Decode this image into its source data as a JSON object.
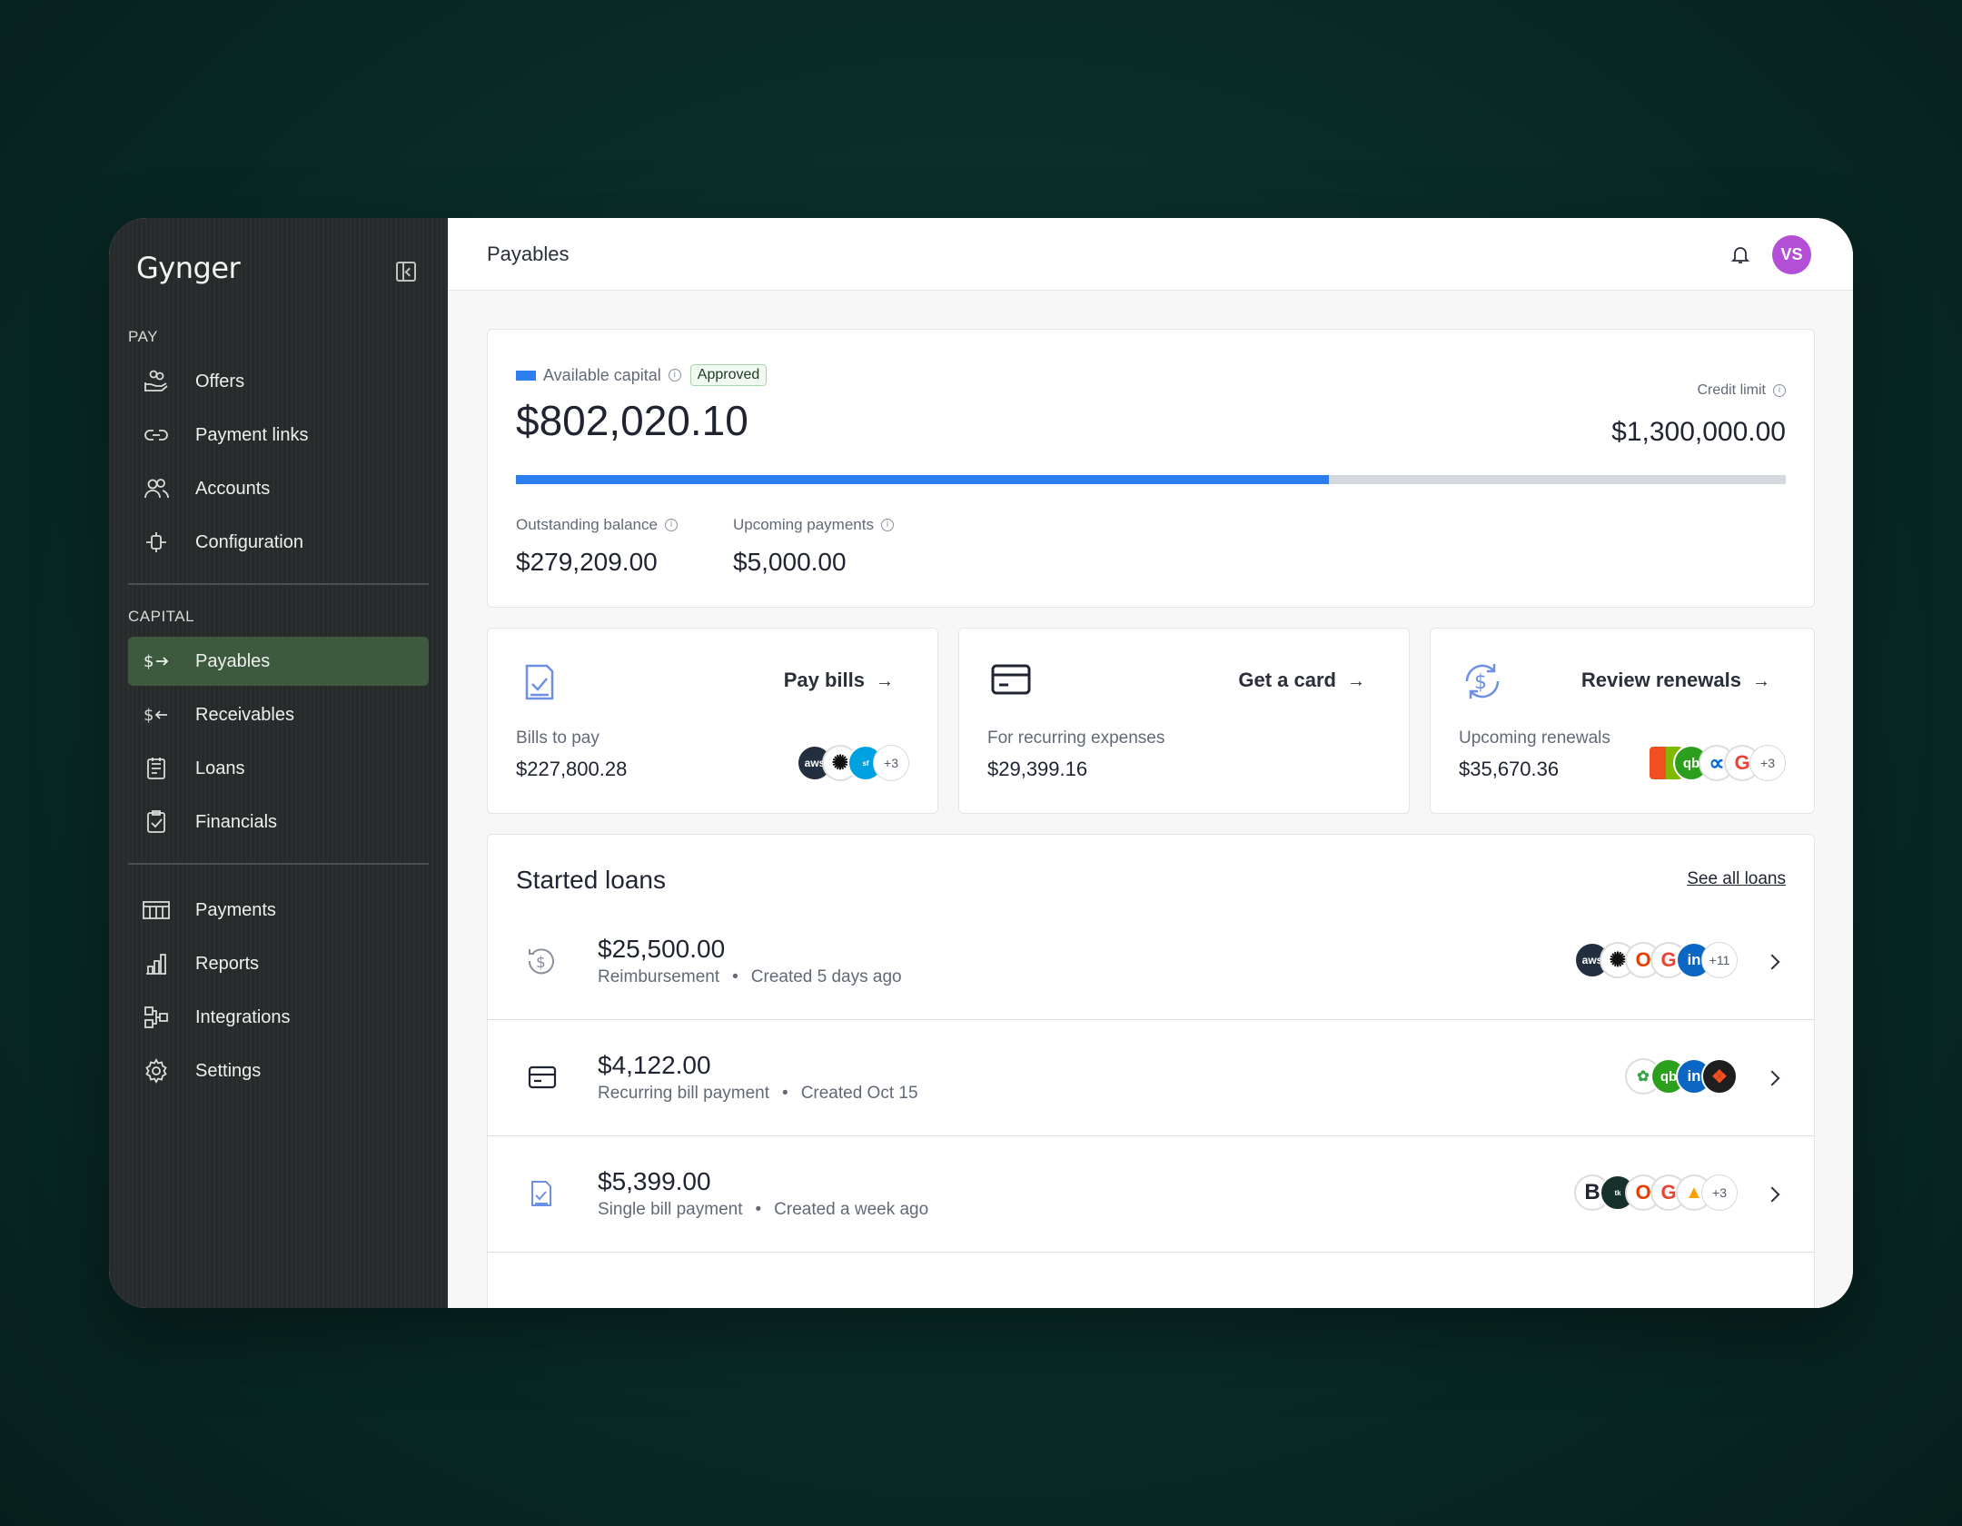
{
  "app": {
    "logo": "Gynger"
  },
  "sidebar": {
    "pay_section": "PAY",
    "pay_items": [
      {
        "label": "Offers",
        "icon": "offers-icon"
      },
      {
        "label": "Payment links",
        "icon": "link-icon"
      },
      {
        "label": "Accounts",
        "icon": "users-icon"
      },
      {
        "label": "Configuration",
        "icon": "configuration-icon"
      }
    ],
    "capital_section": "CAPITAL",
    "capital_items": [
      {
        "label": "Payables",
        "icon": "payables-icon",
        "active": true
      },
      {
        "label": "Receivables",
        "icon": "receivables-icon"
      },
      {
        "label": "Loans",
        "icon": "loans-icon"
      },
      {
        "label": "Financials",
        "icon": "financials-icon"
      }
    ],
    "other_items": [
      {
        "label": "Payments",
        "icon": "payments-icon"
      },
      {
        "label": "Reports",
        "icon": "reports-icon"
      },
      {
        "label": "Integrations",
        "icon": "integrations-icon"
      },
      {
        "label": "Settings",
        "icon": "gear-icon"
      }
    ]
  },
  "header": {
    "title": "Payables",
    "avatar_initials": "VS",
    "avatar_color": "#b24fd6"
  },
  "capital": {
    "available_label": "Available capital",
    "status": "Approved",
    "available_amount": "$802,020.10",
    "credit_limit_label": "Credit limit",
    "credit_limit": "$1,300,000.00",
    "utilization_fraction": 0.64,
    "bar_color": "#2d7ff0",
    "outstanding_label": "Outstanding balance",
    "outstanding_amount": "$279,209.00",
    "upcoming_label": "Upcoming payments",
    "upcoming_amount": "$5,000.00"
  },
  "actions": [
    {
      "title": "Pay bills",
      "sub_label": "Bills to pay",
      "amount": "$227,800.28",
      "icon": "bill-check-icon",
      "more": "+3"
    },
    {
      "title": "Get a card",
      "sub_label": "For recurring expenses",
      "amount": "$29,399.16",
      "icon": "credit-card-icon"
    },
    {
      "title": "Review renewals",
      "sub_label": "Upcoming renewals",
      "amount": "$35,670.36",
      "icon": "renewal-dollar-icon",
      "more": "+3"
    }
  ],
  "loans": {
    "title": "Started loans",
    "see_all": "See all loans",
    "rows": [
      {
        "amount": "$25,500.00",
        "type": "Reimbursement",
        "created": "Created 5 days ago",
        "icon": "dollar-refresh-icon",
        "more": "+11"
      },
      {
        "amount": "$4,122.00",
        "type": "Recurring bill payment",
        "created": "Created Oct 15",
        "icon": "credit-card-icon"
      },
      {
        "amount": "$5,399.00",
        "type": "Single bill payment",
        "created": "Created a week ago",
        "icon": "bill-check-icon",
        "more": "+3"
      }
    ]
  }
}
